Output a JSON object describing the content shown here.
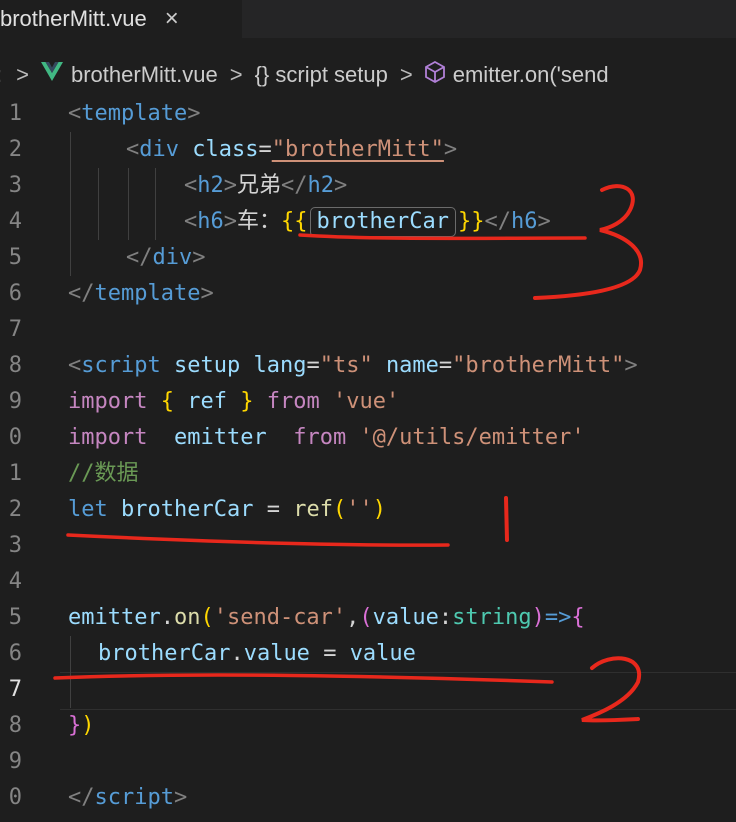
{
  "tab": {
    "title": "brotherMitt.vue",
    "close_icon": "×"
  },
  "breadcrumb": {
    "lead_sep": ":",
    "items": [
      "brotherMitt.vue",
      "{} script setup",
      "emitter.on('send"
    ]
  },
  "line_numbers": [
    "1",
    "2",
    "3",
    "4",
    "5",
    "6",
    "7",
    "8",
    "9",
    "0",
    "1",
    "2",
    "3",
    "4",
    "5",
    "6",
    "7",
    "8",
    "9",
    "0"
  ],
  "code": {
    "l1": {
      "open": "<",
      "tag": "template",
      "close": ">"
    },
    "l2": {
      "open": "<",
      "tag": "div",
      "attr": "class",
      "eq": "=",
      "val": "\"brotherMitt\"",
      "close": ">"
    },
    "l3": {
      "open": "<",
      "tag": "h2",
      "close": ">",
      "text": "兄弟",
      "end_open": "</",
      "end_tag": "h2",
      "end_close": ">"
    },
    "l4": {
      "open": "<",
      "tag": "h6",
      "close": ">",
      "text": "车：",
      "mustache_open": "{{",
      "expr": "brotherCar",
      "mustache_close": "}}",
      "end_open": "</",
      "end_tag": "h6",
      "end_close": ">"
    },
    "l5": {
      "open": "</",
      "tag": "div",
      "close": ">"
    },
    "l6": {
      "open": "</",
      "tag": "template",
      "close": ">"
    },
    "l8": {
      "open": "<",
      "tag": "script",
      "a1": "setup",
      "a2": "lang",
      "eq": "=",
      "v2": "\"ts\"",
      "a3": "name",
      "v3": "\"brotherMitt\"",
      "close": ">"
    },
    "l9": {
      "kw": "import",
      "lb": "{",
      "name": "ref",
      "rb": "}",
      "from": "from",
      "src": "'vue'"
    },
    "l10": {
      "kw": "import",
      "name": "emitter",
      "from": "from",
      "src": "'@/utils/emitter'"
    },
    "l11": {
      "comment": "//数据"
    },
    "l12": {
      "kw": "let",
      "name": "brotherCar",
      "eq": "=",
      "fn": "ref",
      "lp": "(",
      "arg": "''",
      "rp": ")"
    },
    "l15": {
      "obj": "emitter",
      "dot": ".",
      "fn": "on",
      "lp": "(",
      "evt": "'send-car'",
      "comma": ",",
      "lp2": "(",
      "param": "value",
      "colon": ":",
      "type": "string",
      "rp2": ")",
      "arrow": "=>",
      "lb": "{"
    },
    "l16": {
      "obj": "brotherCar",
      "dot": ".",
      "prop": "value",
      "eq": "=",
      "val": "value"
    },
    "l18": {
      "rb": "}",
      "rp": ")"
    },
    "l20": {
      "open": "</",
      "tag": "script",
      "close": ">"
    }
  },
  "annotations": {
    "color": "#e8281c",
    "marks": [
      "3",
      "1",
      "2"
    ]
  }
}
